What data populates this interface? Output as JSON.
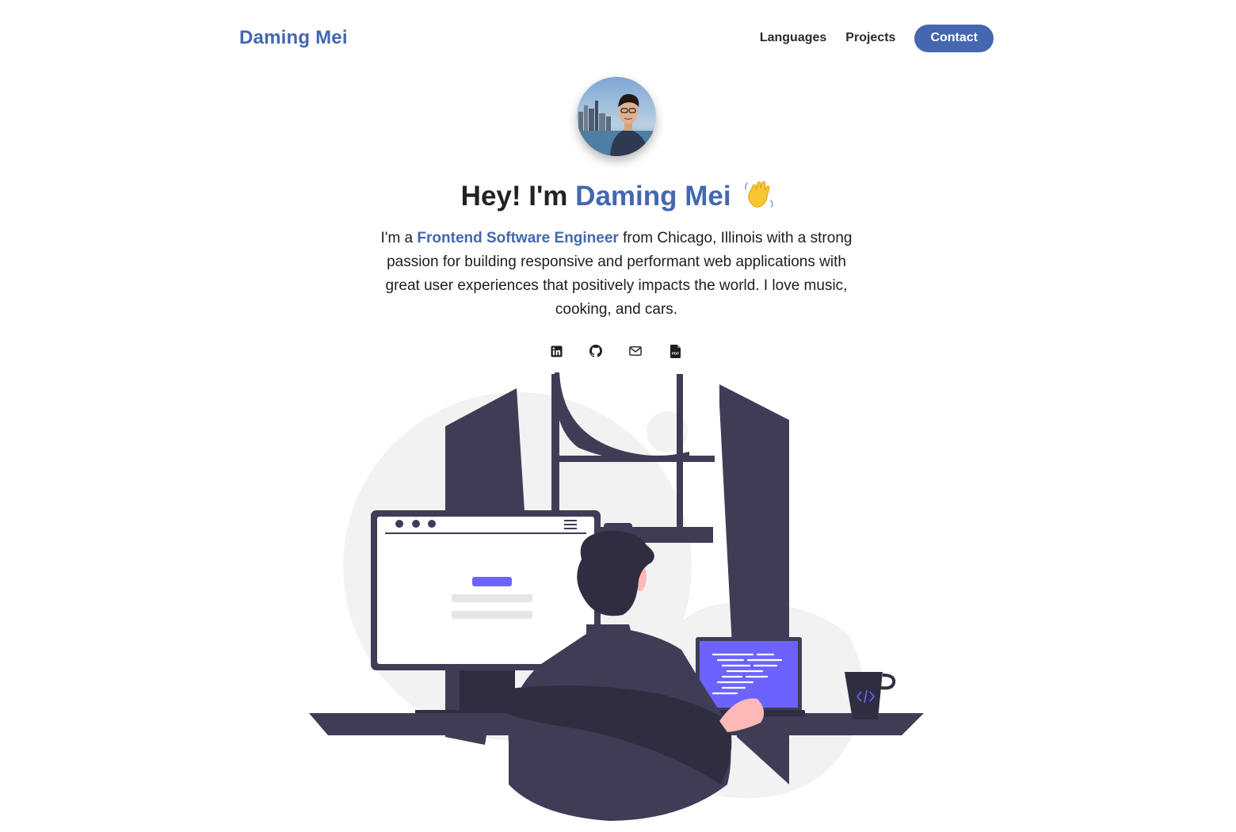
{
  "header": {
    "logo": "Daming Mei",
    "nav": {
      "languages": "Languages",
      "projects": "Projects",
      "contact": "Contact"
    }
  },
  "hero": {
    "greeting": "Hey! I'm",
    "name": "Daming Mei",
    "bio_prefix": "I'm a",
    "role": "Frontend Software Engineer",
    "bio_rest": "from Chicago, Illinois with a strong passion for building responsive and performant web applications with great user experiences that positively impacts the world. I love music, cooking, and cars."
  },
  "socials": [
    {
      "icon": "linkedin-icon"
    },
    {
      "icon": "github-icon"
    },
    {
      "icon": "mail-icon"
    },
    {
      "icon": "pdf-icon"
    }
  ],
  "colors": {
    "accent": "#4467b0",
    "illustration_dark": "#3f3d56",
    "illustration_purple": "#6c63ff",
    "skin": "#ffb8b8"
  }
}
